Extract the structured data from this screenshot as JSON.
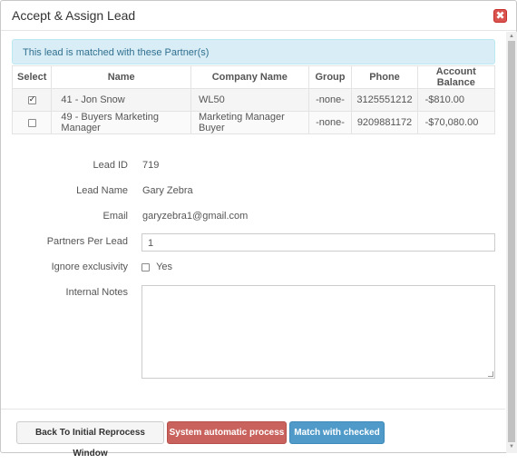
{
  "modal": {
    "title": "Accept & Assign Lead",
    "close_glyph": "✖"
  },
  "alert": {
    "text": "This lead is matched with these Partner(s)"
  },
  "table": {
    "headers": [
      "Select",
      "Name",
      "Company Name",
      "Group",
      "Phone",
      "Account Balance"
    ],
    "rows": [
      {
        "checked": true,
        "name": "41 - Jon Snow",
        "company": "WL50",
        "group": "-none-",
        "phone": "3125551212",
        "balance": "-$810.00"
      },
      {
        "checked": false,
        "name": "49 - Buyers Marketing Manager",
        "company": "Marketing Manager Buyer",
        "group": "-none-",
        "phone": "9209881172",
        "balance": "-$70,080.00"
      }
    ]
  },
  "form": {
    "lead_id_label": "Lead ID",
    "lead_id_value": "719",
    "lead_name_label": "Lead Name",
    "lead_name_value": "Gary Zebra",
    "email_label": "Email",
    "email_value": "garyzebra1@gmail.com",
    "partners_per_lead_label": "Partners Per Lead",
    "partners_per_lead_value": "1",
    "ignore_exclusivity_label": "Ignore exclusivity",
    "ignore_exclusivity_option": "Yes",
    "internal_notes_label": "Internal Notes",
    "internal_notes_value": ""
  },
  "footer": {
    "back_label": "Back To Initial Reprocess Window",
    "auto_label": "System automatic process",
    "match_label": "Match with checked"
  },
  "colors": {
    "alert_bg": "#d9edf7",
    "danger": "#c9625d",
    "primary": "#4f9ac9",
    "close": "#d9534f"
  }
}
